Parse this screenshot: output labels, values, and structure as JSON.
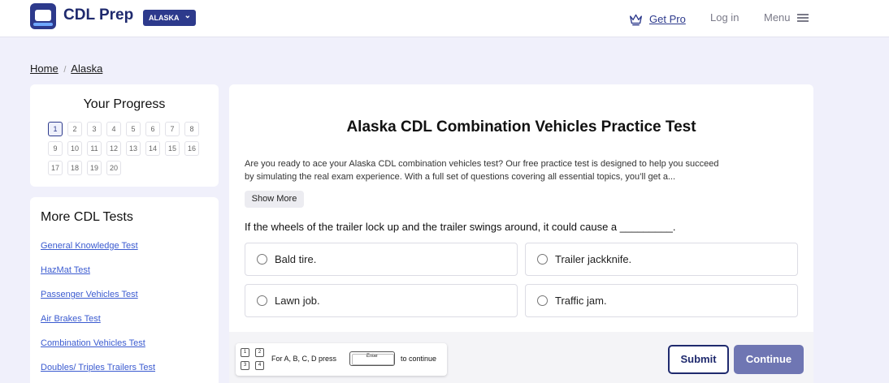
{
  "header": {
    "logo_text": "CDL Prep",
    "state_selector": "ALASKA",
    "get_pro": "Get Pro",
    "login": "Log in",
    "menu": "Menu"
  },
  "breadcrumb": {
    "home": "Home",
    "separator": "/",
    "state": "Alaska"
  },
  "progress": {
    "title": "Your Progress",
    "current": 1,
    "cells": [
      "1",
      "2",
      "3",
      "4",
      "5",
      "6",
      "7",
      "8",
      "9",
      "10",
      "11",
      "12",
      "13",
      "14",
      "15",
      "16",
      "17",
      "18",
      "19",
      "20"
    ]
  },
  "more_tests": {
    "title": "More CDL Tests",
    "links": [
      "General Knowledge Test",
      "HazMat Test",
      "Passenger Vehicles Test",
      "Air Brakes Test",
      "Combination Vehicles Test",
      "Doubles/ Triples Trailers Test"
    ]
  },
  "test": {
    "title": "Alaska CDL Combination Vehicles Practice Test",
    "intro_line1": "Are you ready to ace your Alaska CDL combination vehicles test? Our free practice test is designed to help you succeed",
    "intro_line2": "by simulating the real exam experience. With a full set of questions covering all essential topics, you’ll get a...",
    "show_more": "Show More",
    "question": "If the wheels of the trailer lock up and the trailer swings around, it could cause a _________.",
    "options": [
      "Bald tire.",
      "Trailer jackknife.",
      "Lawn job.",
      "Traffic jam."
    ]
  },
  "footer": {
    "keys": [
      "1",
      "2",
      "3",
      "4"
    ],
    "hint_prefix": "For A, B, C, D  press",
    "enter_key": "Enter",
    "hint_suffix": "to continue",
    "submit": "Submit",
    "continue": "Continue"
  },
  "colors": {
    "brand": "#2d3a8c",
    "page_background": "#f0f0fb",
    "link": "#3b5bd0",
    "continue_button": "#6f76b3"
  },
  "icons": [
    "truck-logo-icon",
    "chevron-down-icon",
    "crown-icon",
    "hamburger-icon",
    "radio-icon"
  ]
}
